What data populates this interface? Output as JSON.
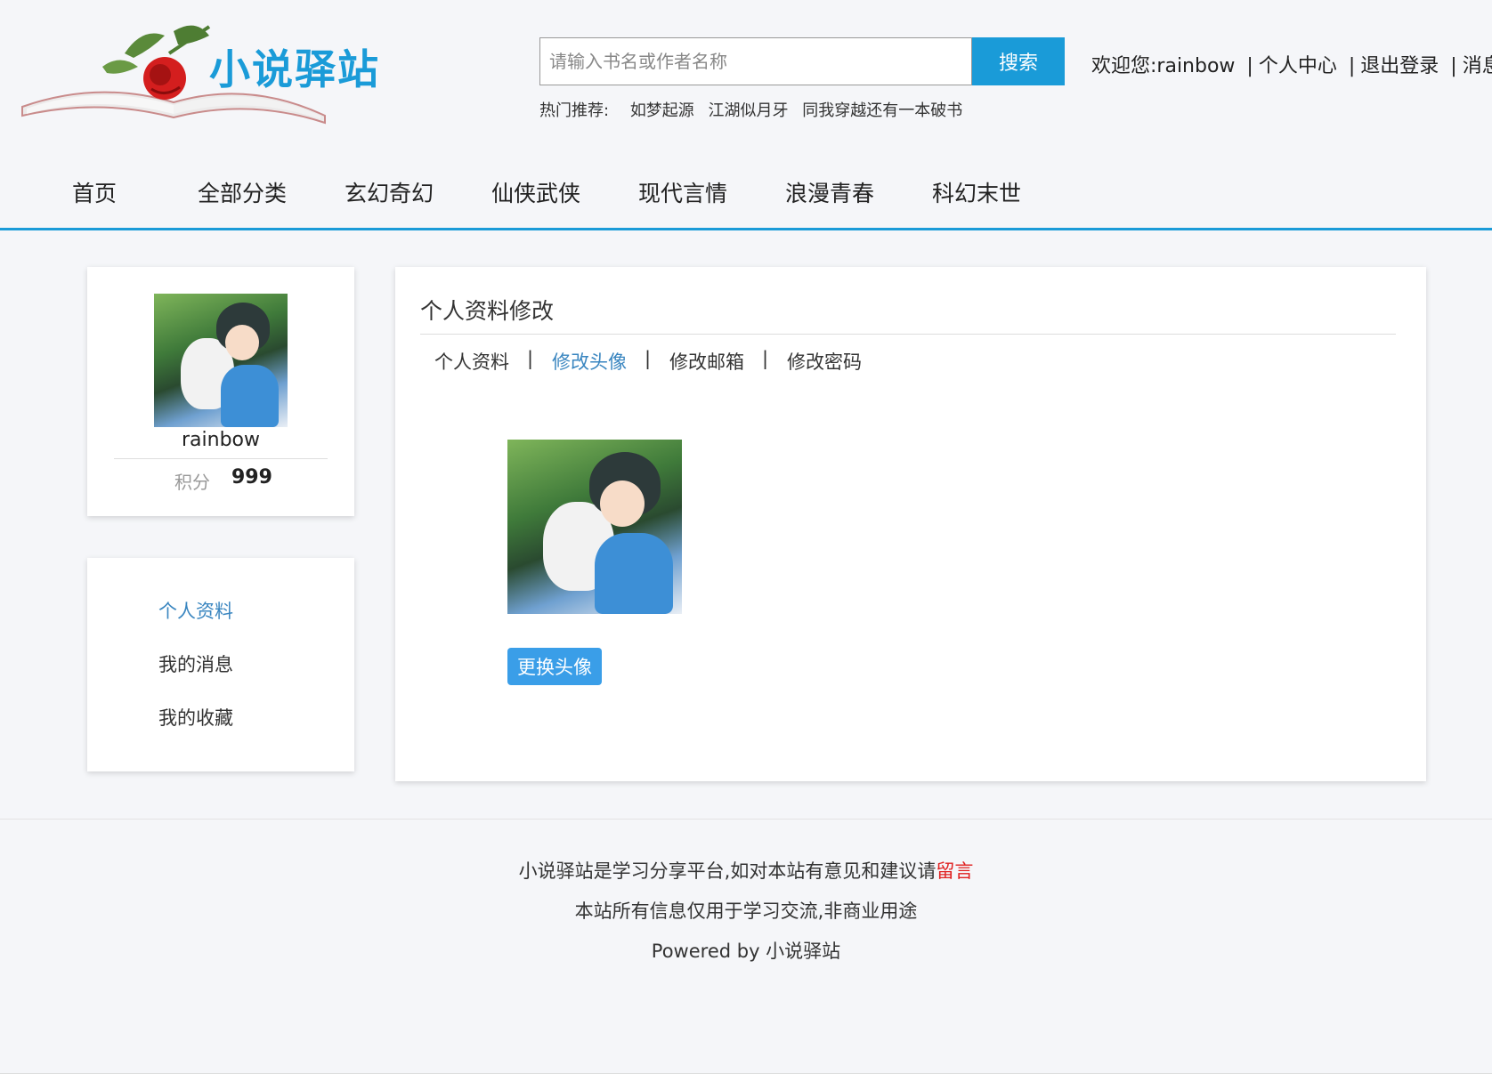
{
  "site": {
    "logo_text": "小说驿站"
  },
  "search": {
    "placeholder": "请输入书名或作者名称",
    "button_label": "搜索"
  },
  "hot": {
    "label": "热门推荐:",
    "items": [
      "如梦起源",
      "江湖似月牙",
      "同我穿越还有一本破书"
    ]
  },
  "user_bar": {
    "welcome": "欢迎您:",
    "username": "rainbow",
    "links": [
      "个人中心",
      "退出登录",
      "消息"
    ],
    "separator": "|"
  },
  "nav": {
    "items": [
      "首页",
      "全部分类",
      "玄幻奇幻",
      "仙侠武侠",
      "现代言情",
      "浪漫青春",
      "科幻末世"
    ]
  },
  "profile_card": {
    "username": "rainbow",
    "score_label": "积分",
    "score_value": "999"
  },
  "side_menu": {
    "items": [
      "个人资料",
      "我的消息",
      "我的收藏"
    ],
    "active_index": 0
  },
  "panel": {
    "title": "个人资料修改",
    "tabs": [
      "个人资料",
      "修改头像",
      "修改邮箱",
      "修改密码"
    ],
    "tab_separator": "|",
    "active_tab": 1,
    "change_button_label": "更换头像"
  },
  "footer": {
    "line1_prefix": "小说驿站是学习分享平台,如对本站有意见和建议请",
    "line1_link": "留言",
    "line2": "本站所有信息仅用于学习交流,非商业用途",
    "line3": "Powered by 小说驿站"
  },
  "colors": {
    "accent": "#1a9bd8",
    "link_active": "#3a86c0",
    "footer_link": "#e02020",
    "background": "#f5f6f9"
  }
}
